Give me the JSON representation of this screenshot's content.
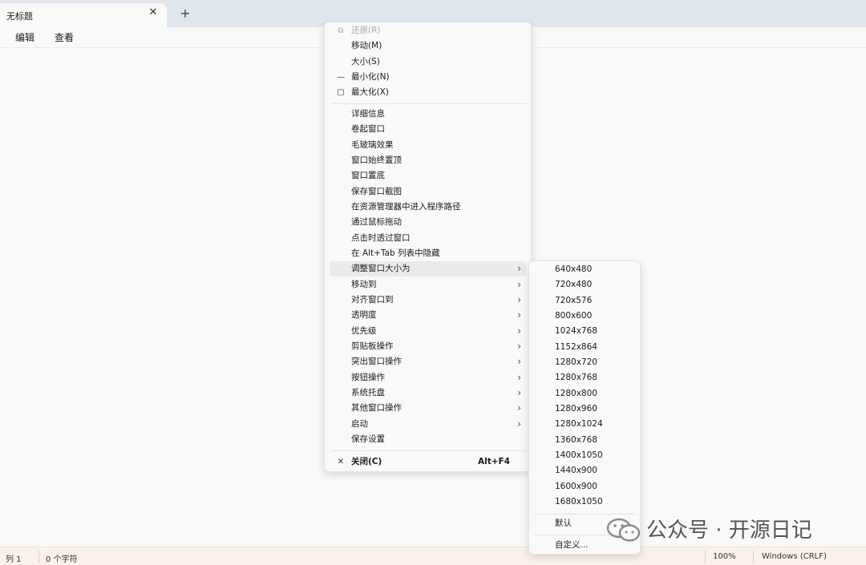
{
  "tab": {
    "title": "无标题",
    "close_icon": "✕",
    "add_icon": "+"
  },
  "menubar": {
    "items": [
      "编辑",
      "查看"
    ]
  },
  "context_menu": {
    "items": [
      {
        "label": "还原(R)",
        "icon": "restore-icon",
        "disabled": true
      },
      {
        "label": "移动(M)"
      },
      {
        "label": "大小(S)"
      },
      {
        "label": "最小化(N)",
        "icon": "minimize-icon"
      },
      {
        "label": "最大化(X)",
        "icon": "maximize-icon"
      },
      {
        "label": "详细信息"
      },
      {
        "label": "卷起窗口"
      },
      {
        "label": "毛玻璃效果"
      },
      {
        "label": "窗口始终置顶"
      },
      {
        "label": "窗口置底"
      },
      {
        "label": "保存窗口截图"
      },
      {
        "label": "在资源管理器中进入程序路径"
      },
      {
        "label": "通过鼠标拖动"
      },
      {
        "label": "点击时透过窗口"
      },
      {
        "label": "在 Alt+Tab 列表中隐藏"
      },
      {
        "label": "调整窗口大小为",
        "submenu": true,
        "highlighted": true
      },
      {
        "label": "移动到",
        "submenu": true
      },
      {
        "label": "对齐窗口到",
        "submenu": true
      },
      {
        "label": "透明度",
        "submenu": true
      },
      {
        "label": "优先级",
        "submenu": true
      },
      {
        "label": "剪贴板操作",
        "submenu": true
      },
      {
        "label": "突出窗口操作",
        "submenu": true
      },
      {
        "label": "按钮操作",
        "submenu": true
      },
      {
        "label": "系统托盘",
        "submenu": true
      },
      {
        "label": "其他窗口操作",
        "submenu": true
      },
      {
        "label": "启动",
        "submenu": true
      },
      {
        "label": "保存设置"
      },
      {
        "label": "关闭(C)",
        "icon": "close-icon",
        "shortcut": "Alt+F4",
        "bold": true
      }
    ],
    "arrow_glyph": "›"
  },
  "submenu": {
    "items": [
      "640x480",
      "720x480",
      "720x576",
      "800x600",
      "1024x768",
      "1152x864",
      "1280x720",
      "1280x768",
      "1280x800",
      "1280x960",
      "1280x1024",
      "1360x768",
      "1400x1050",
      "1440x900",
      "1600x900",
      "1680x1050",
      "默认",
      "自定义..."
    ]
  },
  "statusbar": {
    "position": "列 1",
    "char_count": "0 个字符",
    "zoom": "100%",
    "line_ending": "Windows (CRLF)"
  },
  "watermark": {
    "text": "公众号 · 开源日记",
    "icon": "wechat-logo-icon"
  }
}
